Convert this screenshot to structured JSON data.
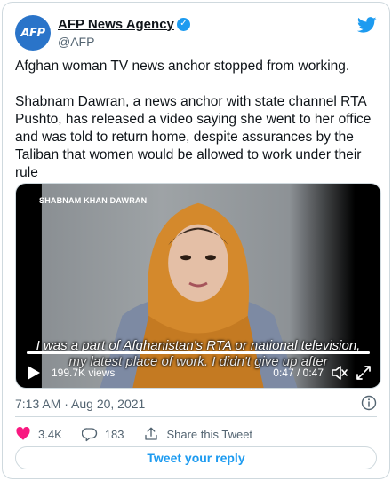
{
  "author": {
    "avatar_text": "AFP",
    "name": "AFP News Agency",
    "handle": "@AFP",
    "verified": true
  },
  "icons": {
    "brand": "twitter-bird-icon",
    "verified": "verified-badge-icon"
  },
  "tweet": {
    "paragraph_1": "Afghan woman TV news anchor stopped from working.",
    "paragraph_2": "Shabnam Dawran, a news anchor with state channel RTA Pushto, has released a video saying she went to her office and was told to return home, despite assurances by the Taliban that women would be allowed to work under their rule"
  },
  "video": {
    "lower_third": "SHABNAM KHAN DAWRAN",
    "subtitle_line_1": "I was a part of Afghanistan's RTA or national television,",
    "subtitle_line_2": "my latest place of work. I didn't give up after",
    "views": "199.7K views",
    "time": "0:47 / 0:47",
    "progress": 1.0
  },
  "meta": {
    "timestamp": "7:13 AM · Aug 20, 2021"
  },
  "actions": {
    "likes": "3.4K",
    "replies": "183",
    "share_label": "Share this Tweet"
  },
  "reply_button": "Tweet your reply",
  "colors": {
    "accent": "#1d9bf0",
    "like": "#f91880",
    "secondary_text": "#536471",
    "border": "#cfd9de",
    "avatar_bg": "#2a74c9"
  }
}
